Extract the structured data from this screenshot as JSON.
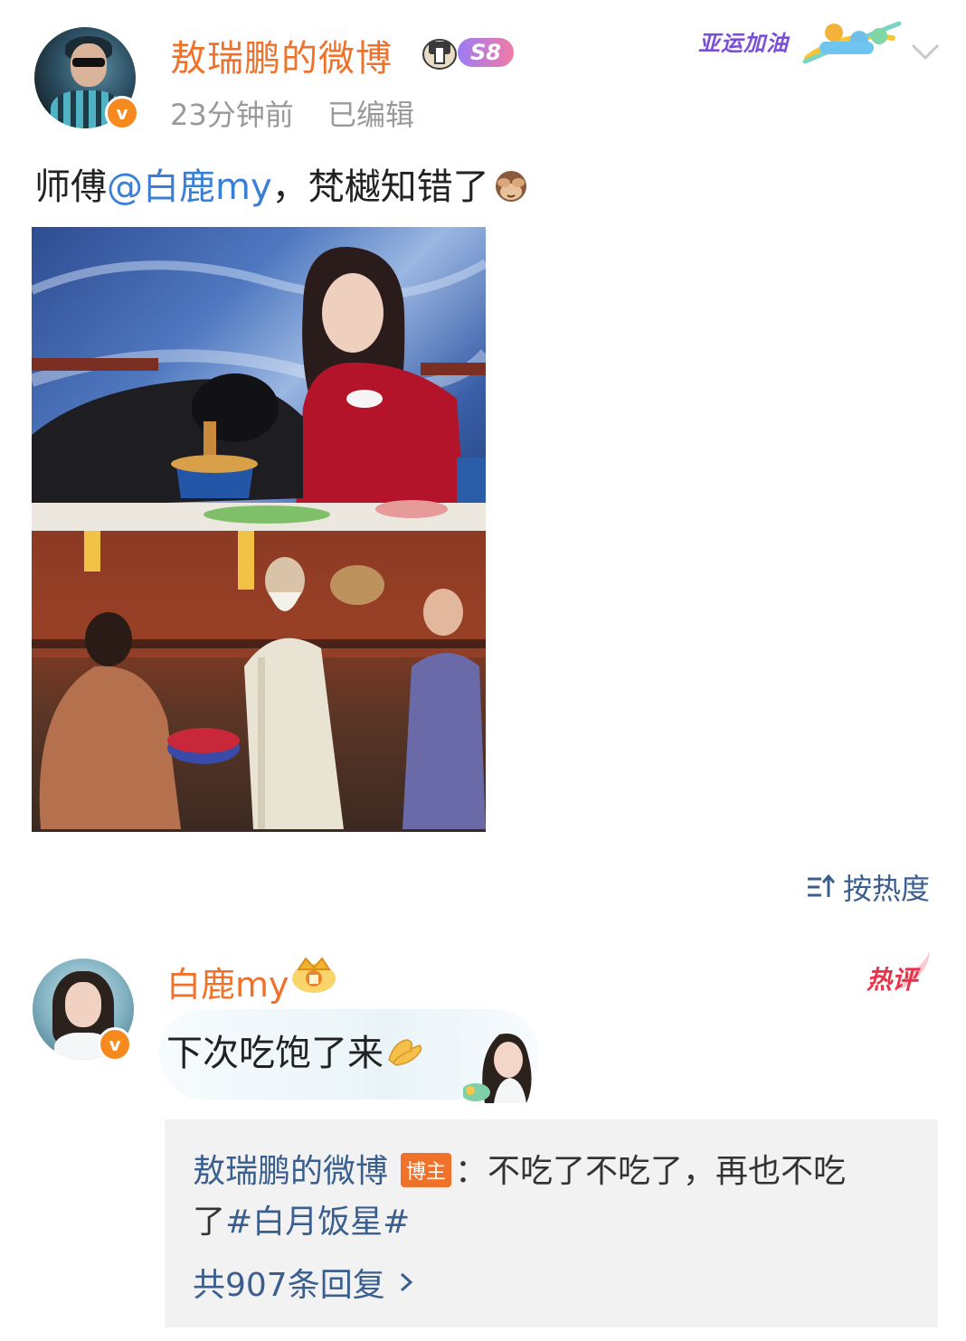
{
  "post": {
    "author_name": "敖瑞鹏的微博",
    "level_badge": "S8",
    "verified_icon": "v-verified-icon",
    "time": "23分钟前",
    "edited": "已编辑",
    "banner_text": "亚运加油",
    "text_prefix": "师傅",
    "mention": "@白鹿my",
    "text_suffix": "，梵樾知错了",
    "emoji": "see-no-evil-monkey-icon"
  },
  "sort": {
    "label": "按热度",
    "icon": "sort-icon"
  },
  "comment": {
    "author_name": "白鹿my",
    "hot_label": "热评",
    "text": "下次吃饱了来",
    "emoji": "clapping-hands-icon",
    "reply": {
      "author": "敖瑞鹏的微博",
      "host_badge": "博主",
      "colon": "：",
      "text_line1": "不吃了不吃了，再也不吃",
      "text_line2_prefix": "了",
      "topic": "#白月饭星#",
      "count_text": "共907条回复"
    }
  },
  "colors": {
    "name_orange": "#f0722a",
    "link_blue": "#3a7fd6",
    "meta_gray": "#999999",
    "hot_red": "#e8344a",
    "reply_bg": "#f2f2f2"
  }
}
